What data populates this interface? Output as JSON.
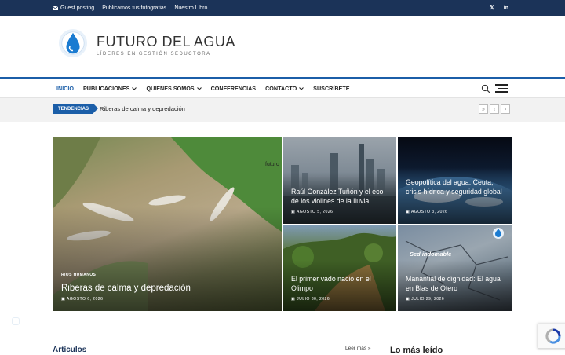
{
  "topbar": {
    "links": [
      {
        "label": "Guest posting",
        "icon": "mail-icon"
      },
      {
        "label": "Publicamos tus fotografias"
      },
      {
        "label": "Nuestro Libro"
      }
    ],
    "social": [
      "x-icon",
      "linkedin-icon"
    ],
    "social_glyphs": [
      "𝕏",
      "in"
    ]
  },
  "header": {
    "title": "FUTURO DEL AGUA",
    "tagline": "LÍDERES EN GESTIÓN SEDUCTORA"
  },
  "nav": {
    "items": [
      {
        "label": "INICIO",
        "active": true,
        "dropdown": false
      },
      {
        "label": "PUBLICACIONES",
        "active": false,
        "dropdown": true
      },
      {
        "label": "QUIENES SOMOS",
        "active": false,
        "dropdown": true
      },
      {
        "label": "CONFERENCIAS",
        "active": false,
        "dropdown": false
      },
      {
        "label": "CONTACTO",
        "active": false,
        "dropdown": true
      },
      {
        "label": "SUSCRÍBETE",
        "active": false,
        "dropdown": false
      }
    ]
  },
  "trending": {
    "badge": "TENDENCIAS",
    "headline": "Riberas de calma y depredación",
    "controls": [
      "»",
      "‹",
      "›"
    ]
  },
  "featured": [
    {
      "title": "Riberas de calma y depredación",
      "category": "RIOS HUMANOS",
      "date": "AGOSTO 6, 2026",
      "image_text": "futuro"
    },
    {
      "title": "Raúl González Tuñón y el eco de los violines de la lluvia",
      "date": "AGOSTO 5, 2026"
    },
    {
      "title": "Geopolítica del agua: Ceuta, crisis hídrica y seguridad global",
      "date": "AGOSTO 3, 2026"
    },
    {
      "title": "El primer vado nació en el Olimpo",
      "date": "JULIO 30, 2026"
    },
    {
      "title": "Manantial de dignidad: El agua en Blas de Otero",
      "date": "JULIO 29, 2026",
      "image_text": "Sed indomable"
    }
  ],
  "section": {
    "title": "Artículos",
    "more": "Leer más",
    "side_title": "Lo más leído"
  },
  "colors": {
    "topbar": "#1b3358",
    "accent": "#1b5ea8"
  }
}
